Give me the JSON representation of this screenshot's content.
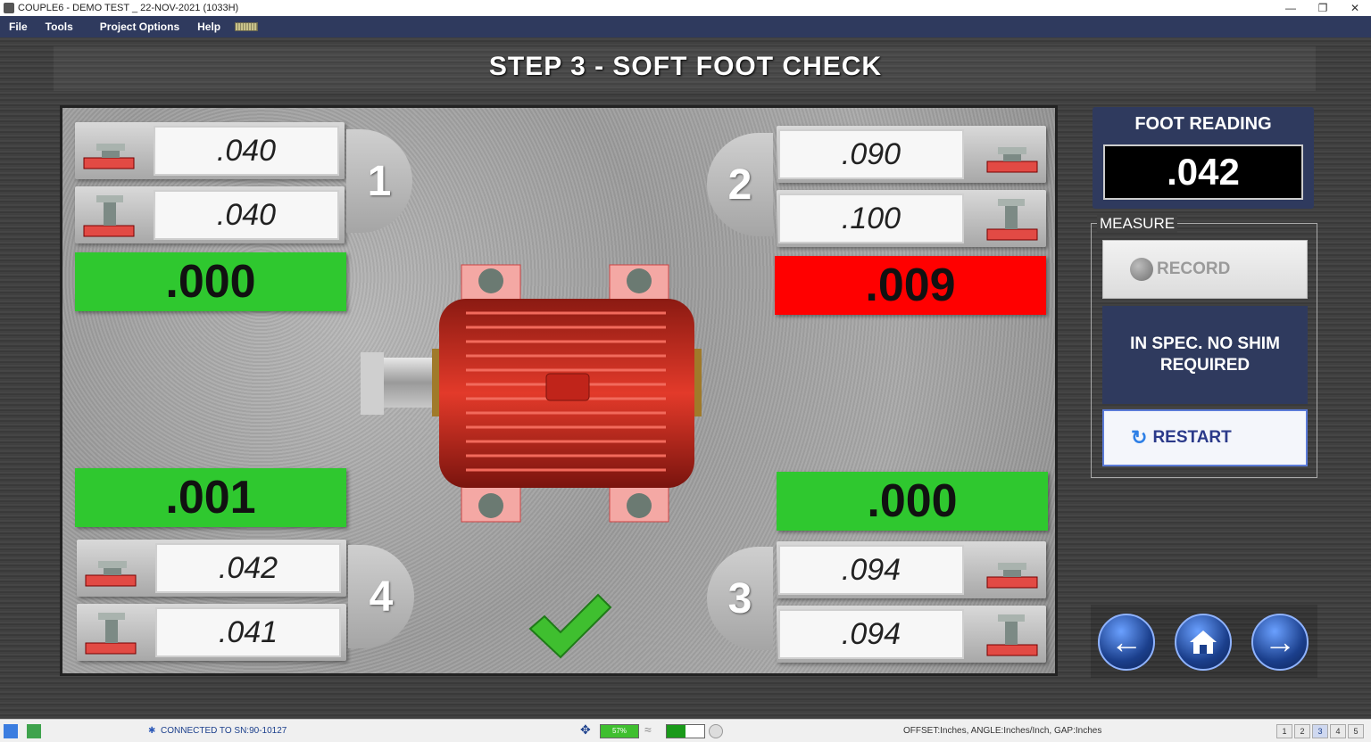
{
  "window": {
    "title": "COUPLE6 - DEMO TEST _ 22-NOV-2021 (1033H)",
    "minimize": "—",
    "restore": "❐",
    "close": "✕"
  },
  "menu": {
    "file": "File",
    "tools": "Tools",
    "project_options": "Project Options",
    "help": "Help"
  },
  "step_title": "STEP 3 - SOFT FOOT CHECK",
  "feet": {
    "foot1": {
      "number": "1",
      "reading_top": ".040",
      "reading_bottom": ".040",
      "result": ".000",
      "result_status": "green"
    },
    "foot2": {
      "number": "2",
      "reading_top": ".090",
      "reading_bottom": ".100",
      "result": ".009",
      "result_status": "red"
    },
    "foot3": {
      "number": "3",
      "reading_top": ".094",
      "reading_bottom": ".094",
      "result": ".000",
      "result_status": "green"
    },
    "foot4": {
      "number": "4",
      "reading_top": ".042",
      "reading_bottom": ".041",
      "result": ".001",
      "result_status": "green"
    }
  },
  "foot_reading": {
    "label": "FOOT READING",
    "value": ".042"
  },
  "measure": {
    "legend": "MEASURE",
    "record_label": "RECORD",
    "spec_message": "IN SPEC. NO SHIM REQUIRED",
    "restart_label": "RESTART"
  },
  "navigation": {
    "back_icon": "arrow-left-icon",
    "home_icon": "home-icon",
    "next_icon": "arrow-right-icon"
  },
  "status": {
    "connection": "CONNECTED TO SN:90-10127",
    "battery_level": "57%",
    "units": "OFFSET:Inches, ANGLE:Inches/Inch, GAP:Inches",
    "pages": [
      "1",
      "2",
      "3",
      "4",
      "5"
    ],
    "active_page": "3"
  },
  "colors": {
    "navy": "#2f3a5e",
    "ok_green": "#2fc82f",
    "fail_red": "#ff0000",
    "motor_red": "#d42a1e"
  }
}
